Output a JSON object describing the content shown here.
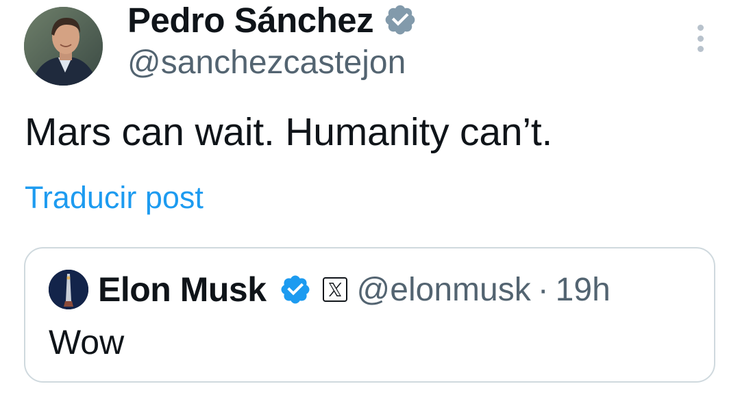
{
  "author": {
    "display_name": "Pedro Sánchez",
    "handle": "@sanchezcastejon",
    "verified_badge": "gray-check-badge-icon",
    "avatar": "profile-photo"
  },
  "more_menu": {
    "icon": "more-vertical-icon"
  },
  "tweet": {
    "text": "Mars can wait. Humanity can’t.",
    "translate_label": "Traducir post"
  },
  "quoted_tweet": {
    "display_name": "Elon Musk",
    "verified_badge": "blue-check-badge-icon",
    "affiliation_badge": "x-logo-icon",
    "handle": "@elonmusk",
    "separator": "·",
    "time": "19h",
    "text": "Wow"
  },
  "colors": {
    "link": "#1d9bf0",
    "secondary_text": "#536471",
    "primary_text": "#0f1419",
    "border": "#cfd9de",
    "verified_blue": "#1d9bf0",
    "verified_gray": "#829aab"
  }
}
